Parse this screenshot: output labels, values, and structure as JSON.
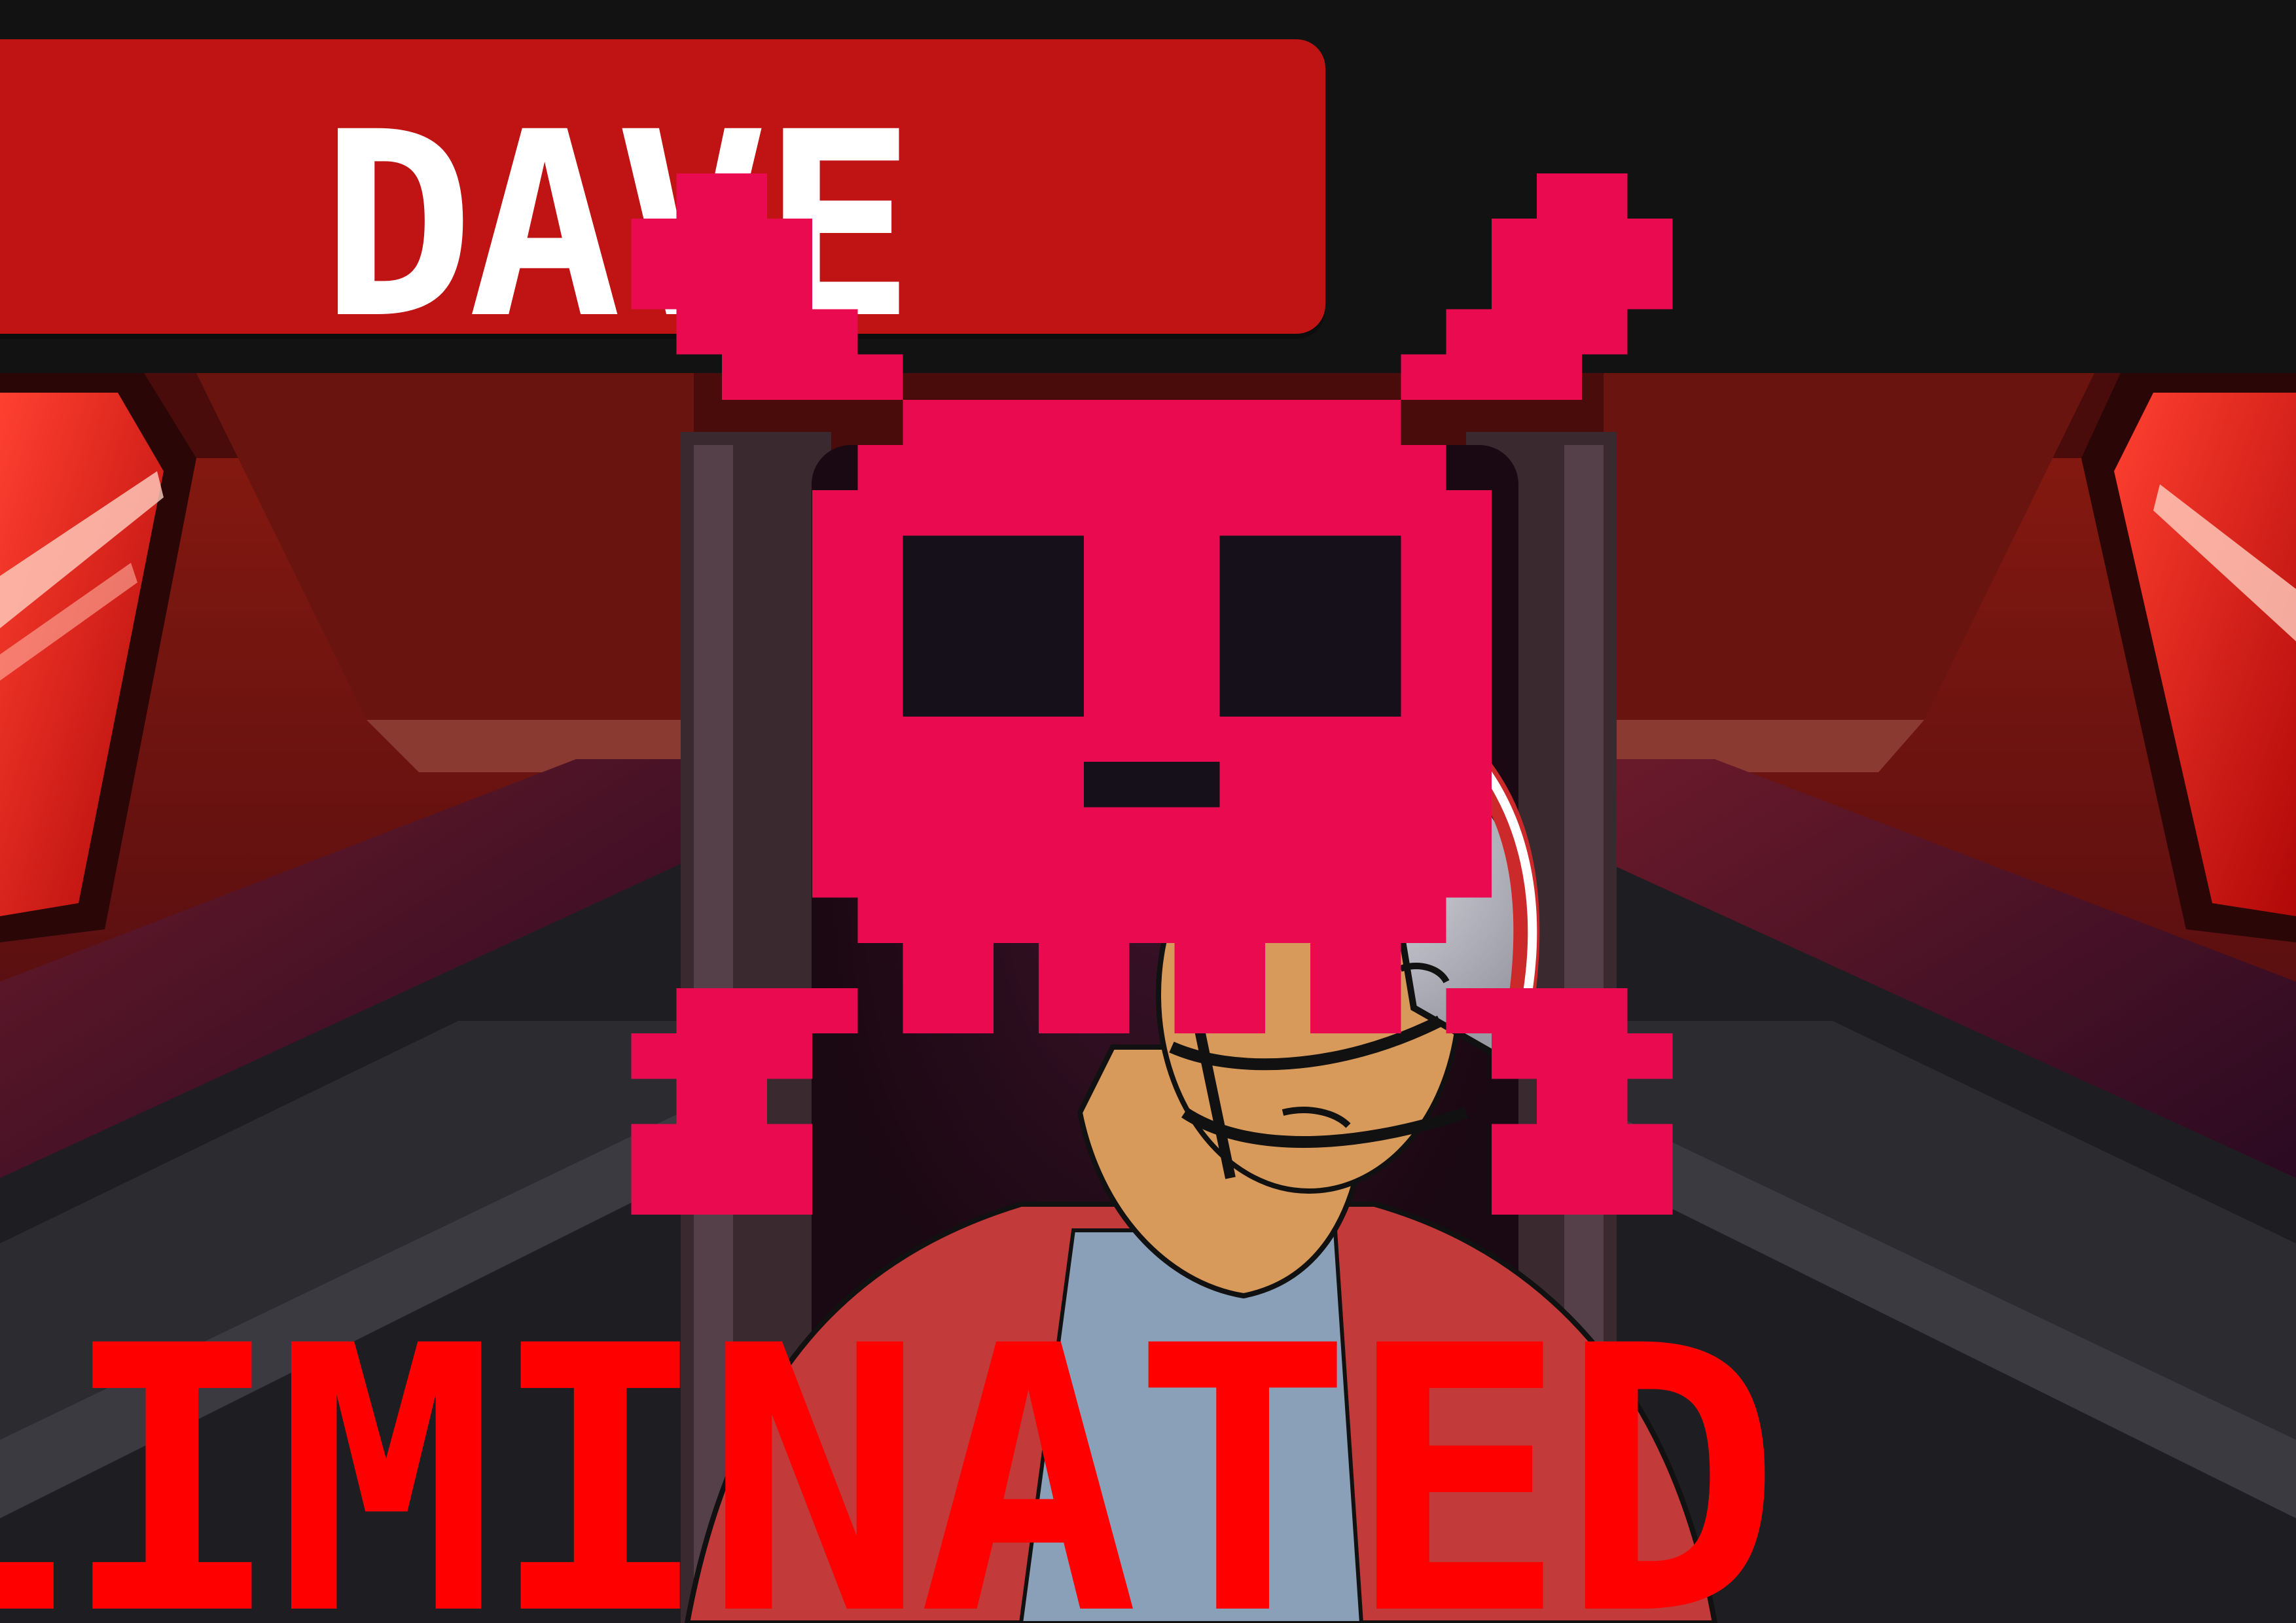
{
  "player": {
    "name": "DAVE"
  },
  "status": {
    "label": "ELIMINATED"
  },
  "icons": {
    "death_icon": "skull-crossbones-icon"
  },
  "colors": {
    "banner": "#c01313",
    "skull": "#ea0a50",
    "status_text": "#ff0000",
    "background": "#121212"
  }
}
